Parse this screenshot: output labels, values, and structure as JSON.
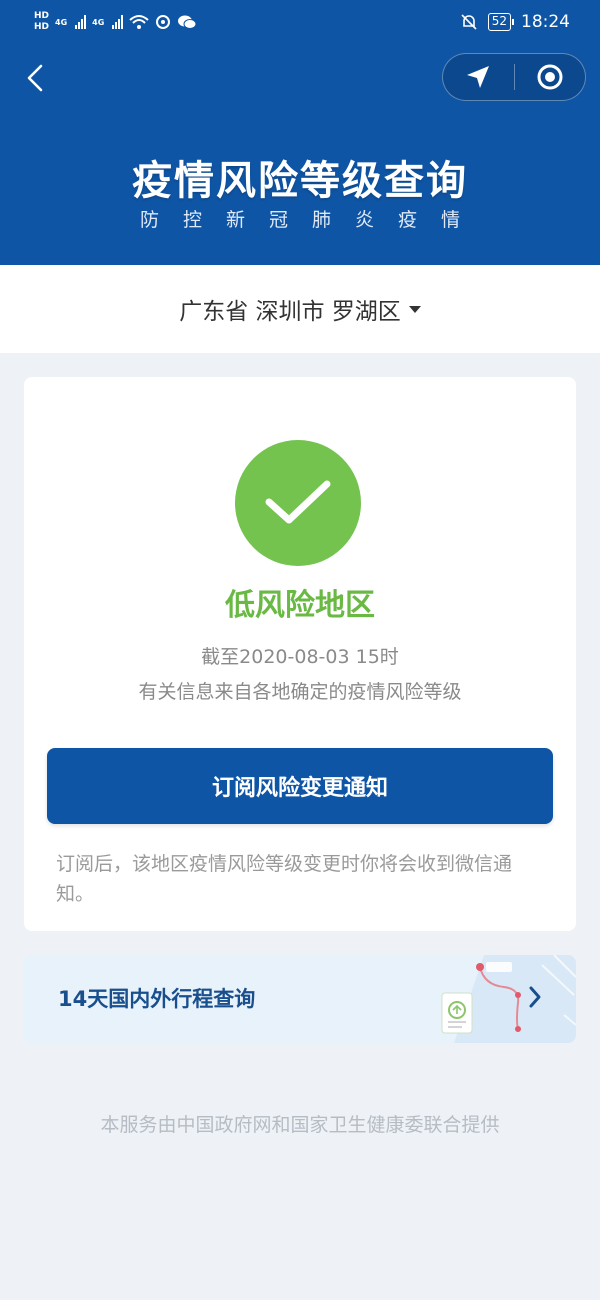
{
  "status_bar": {
    "hd_top": "HD",
    "hd_bottom": "HD",
    "net1": "4G",
    "net2": "4G",
    "battery": "52",
    "time": "18:24"
  },
  "header": {
    "title": "疫情风险等级查询",
    "subtitle": "防控新冠肺炎疫情"
  },
  "location": {
    "text": "广东省 深圳市 罗湖区"
  },
  "risk_card": {
    "level": "低风险地区",
    "as_of": "截至2020-08-03 15时",
    "source_note": "有关信息来自各地确定的疫情风险等级",
    "subscribe_button": "订阅风险变更通知",
    "subscribe_note": "订阅后，该地区疫情风险等级变更时你将会收到微信通知。"
  },
  "travel": {
    "label": "14天国内外行程查询"
  },
  "footer": {
    "text": "本服务由中国政府网和国家卫生健康委联合提供"
  },
  "colors": {
    "brand_blue": "#0f55a5",
    "low_risk_green": "#74c34f",
    "page_bg": "#eef2f7"
  }
}
